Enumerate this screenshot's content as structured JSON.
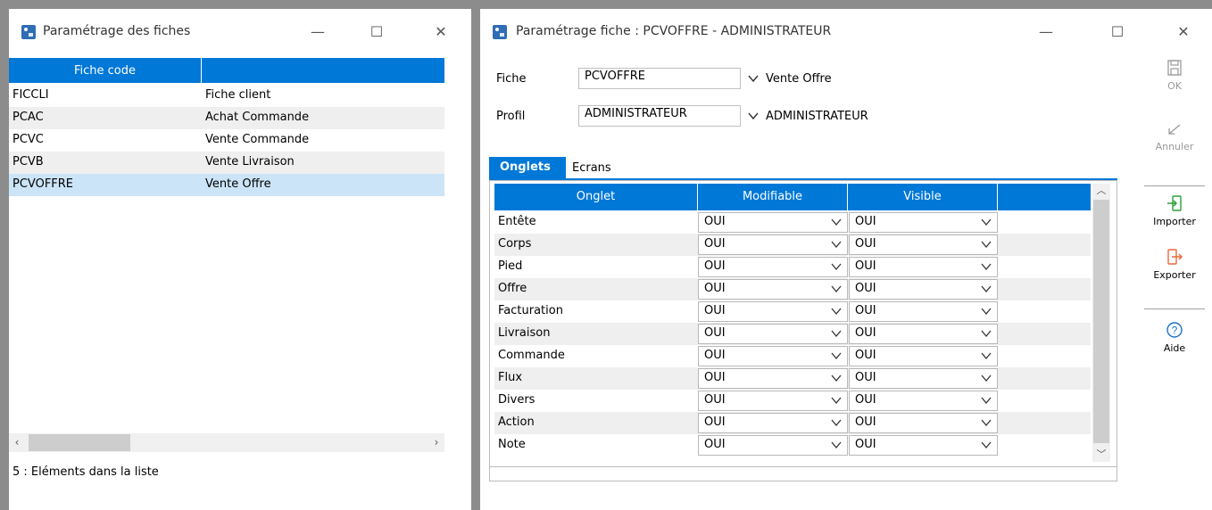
{
  "list_window": {
    "title": "Paramétrage des fiches",
    "column_header": "Fiche code",
    "rows": [
      {
        "code": "FICCLI",
        "label": "Fiche client"
      },
      {
        "code": "PCAC",
        "label": "Achat Commande"
      },
      {
        "code": "PCVC",
        "label": "Vente Commande"
      },
      {
        "code": "PCVB",
        "label": "Vente Livraison"
      },
      {
        "code": "PCVOFFRE",
        "label": "Vente Offre"
      }
    ],
    "status": "5 : Eléments dans la liste",
    "scroll_left": "‹",
    "scroll_right": "›"
  },
  "detail_window": {
    "title": "Paramétrage fiche : PCVOFFRE - ADMINISTRATEUR",
    "fiche_label": "Fiche",
    "fiche_value": "PCVOFFRE",
    "fiche_desc": "Vente Offre",
    "profil_label": "Profil",
    "profil_value": "ADMINISTRATEUR",
    "profil_desc": "ADMINISTRATEUR",
    "tabs": {
      "active": "Onglets",
      "other": "Ecrans"
    },
    "columns": {
      "onglet": "Onglet",
      "modifiable": "Modifiable",
      "visible": "Visible"
    },
    "rows": [
      {
        "name": "Entête",
        "modifiable": "OUI",
        "visible": "OUI"
      },
      {
        "name": "Corps",
        "modifiable": "OUI",
        "visible": "OUI"
      },
      {
        "name": "Pied",
        "modifiable": "OUI",
        "visible": "OUI"
      },
      {
        "name": "Offre",
        "modifiable": "OUI",
        "visible": "OUI"
      },
      {
        "name": "Facturation",
        "modifiable": "OUI",
        "visible": "OUI"
      },
      {
        "name": "Livraison",
        "modifiable": "OUI",
        "visible": "OUI"
      },
      {
        "name": "Commande",
        "modifiable": "OUI",
        "visible": "OUI"
      },
      {
        "name": "Flux",
        "modifiable": "OUI",
        "visible": "OUI"
      },
      {
        "name": "Divers",
        "modifiable": "OUI",
        "visible": "OUI"
      },
      {
        "name": "Action",
        "modifiable": "OUI",
        "visible": "OUI"
      },
      {
        "name": "Note",
        "modifiable": "OUI",
        "visible": "OUI"
      }
    ],
    "sidebar": {
      "ok": "OK",
      "annuler": "Annuler",
      "importer": "Importer",
      "exporter": "Exporter",
      "aide": "Aide"
    }
  },
  "window_controls": {
    "minimize": "—",
    "maximize": "☐",
    "close": "✕"
  },
  "colors": {
    "accent": "#0078d7",
    "selected_row": "#cce4f7",
    "alt_row": "#efefef",
    "import_icon": "#2e9e3a",
    "export_icon": "#e8693a",
    "help_icon": "#1a73c7"
  },
  "icons": [
    "app-icon",
    "save-icon",
    "undo-icon",
    "import-icon",
    "export-icon",
    "help-icon",
    "chevron-down-icon"
  ]
}
